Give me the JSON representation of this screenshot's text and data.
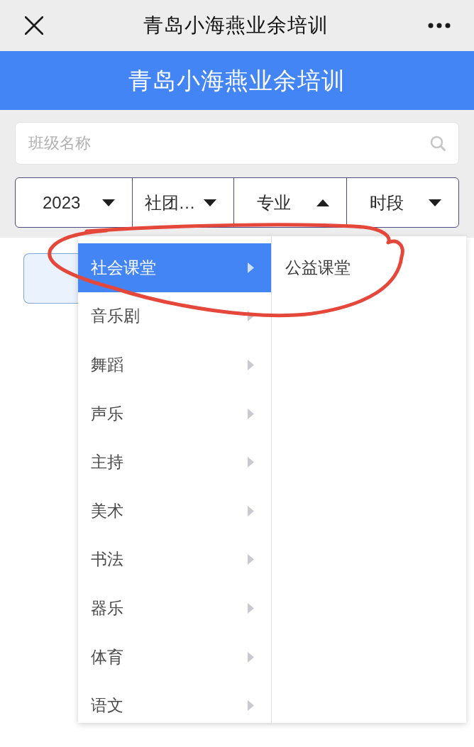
{
  "top_bar": {
    "title": "青岛小海燕业余培训"
  },
  "header": {
    "title": "青岛小海燕业余培训"
  },
  "search": {
    "placeholder": "班级名称"
  },
  "filters": [
    {
      "label": "2023",
      "expanded": false
    },
    {
      "label": "社团…",
      "expanded": false
    },
    {
      "label": "专业",
      "expanded": true
    },
    {
      "label": "时段",
      "expanded": false
    }
  ],
  "dropdown": {
    "categories": [
      {
        "label": "社会课堂",
        "selected": true,
        "children": [
          {
            "label": "公益课堂",
            "selected": false
          }
        ]
      },
      {
        "label": "音乐剧",
        "selected": false
      },
      {
        "label": "舞蹈",
        "selected": false
      },
      {
        "label": "声乐",
        "selected": false
      },
      {
        "label": "主持",
        "selected": false
      },
      {
        "label": "美术",
        "selected": false
      },
      {
        "label": "书法",
        "selected": false
      },
      {
        "label": "器乐",
        "selected": false
      },
      {
        "label": "体育",
        "selected": false
      },
      {
        "label": "语文",
        "selected": false
      }
    ]
  },
  "annotation": {
    "kind": "ellipse"
  }
}
